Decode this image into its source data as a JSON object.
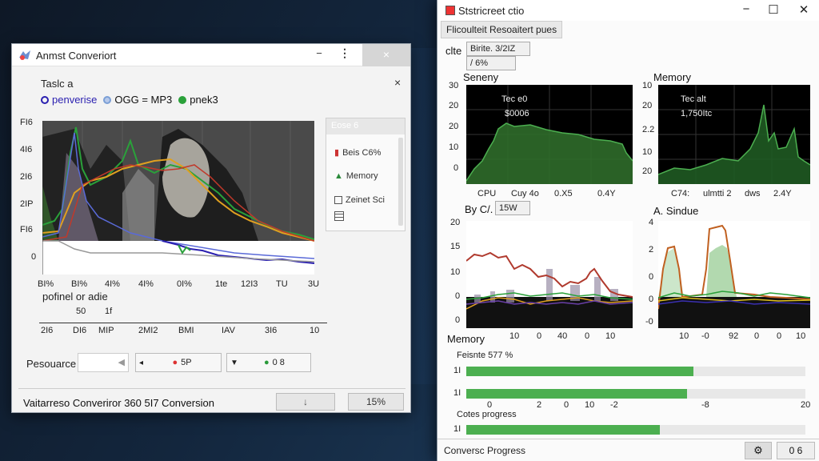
{
  "left_window": {
    "title": "Anmst Converiort",
    "minimize": "−",
    "menu": "⋮",
    "close": "×",
    "panel_title": "Taslc a",
    "panel_close": "×",
    "legend": [
      "penverise",
      "OGG = MP3",
      "pnek3"
    ],
    "legend_colors": [
      "#2a1fb0",
      "#7b9fd6",
      "#2aa13a"
    ],
    "y_ticks": [
      "FI6",
      "4I6",
      "2I6",
      "2IP",
      "FI6",
      "0"
    ],
    "x_ticks": [
      "BI%",
      "BI%",
      "4I%",
      "4I%",
      "0I%",
      "1te",
      "12I3",
      "TU",
      "3U"
    ],
    "side_menu": {
      "header": "Eose 6",
      "items": [
        "Beis C6%",
        "Memory",
        "Zeinet Sci"
      ]
    },
    "sub_label": "pofinel or adie",
    "sub_values": [
      "50",
      "1f"
    ],
    "x2_ticks": [
      "2I6",
      "DI6",
      "MIP",
      "2MI2",
      "BMI",
      "IAV",
      "3I6",
      "10"
    ],
    "resource_label": "Pesouarce",
    "btn1": "5P",
    "btn2": "0 8",
    "status_text": "Vaitarreso Converiror 360 5I7 Conversion",
    "status_down": "↓",
    "status_pct": "15%"
  },
  "right_window": {
    "title": "Ststricreet ctio",
    "tab": "Flicoulteit Resoaitert pues",
    "row1_label": "clte",
    "row1_box": "Birite. 3/2IZ",
    "row1_box2": "/ 6%",
    "cpu_title": "Seneny",
    "mem_title": "Memory",
    "cpu_y": [
      "30",
      "20",
      "20",
      "10",
      "0"
    ],
    "mem_y": [
      "10",
      "20",
      "2.2",
      "10",
      "20"
    ],
    "cpu_text1": "Tec e0",
    "cpu_text2": "$0006",
    "mem_text1": "Tec alt",
    "mem_text2": "1,750Itc",
    "cpu_x": [
      "CPU",
      "Cuy 4o",
      "0.X5",
      "0.4Y"
    ],
    "mem_x": [
      "C74:",
      "ulmtti 2",
      "dws",
      "2.4Y"
    ],
    "byc_label": "By C/.",
    "byc_box": "15W",
    "adt_label": "A. Sindue",
    "lc_y": [
      "20",
      "15",
      "10",
      "0",
      "0"
    ],
    "lc_x": [
      "10",
      "0",
      "40",
      "0",
      "10"
    ],
    "rc_y": [
      "4",
      "2",
      "0",
      "0",
      "-0"
    ],
    "rc_x": [
      "10",
      "-0",
      "92",
      "0",
      "0",
      "10"
    ],
    "memory_section": "Memory",
    "bar1_label": "Feisnte 577 %",
    "bar_rows": [
      {
        "label": "1I",
        "value": 0.67
      },
      {
        "label": "1I",
        "value": 0.65
      }
    ],
    "bar_axis": [
      "0",
      "2",
      "0",
      "10",
      "-2",
      "-8",
      "20"
    ],
    "copy_label": "Cotes progress",
    "bar3": {
      "label": "1I",
      "value": 0.57
    },
    "status_text": "Conversc Progress",
    "status_gear": "⚙",
    "status_pct": "0 6"
  },
  "colors": {
    "green": "#4caf50",
    "orange": "#e07020",
    "blue": "#2a1fb0"
  }
}
